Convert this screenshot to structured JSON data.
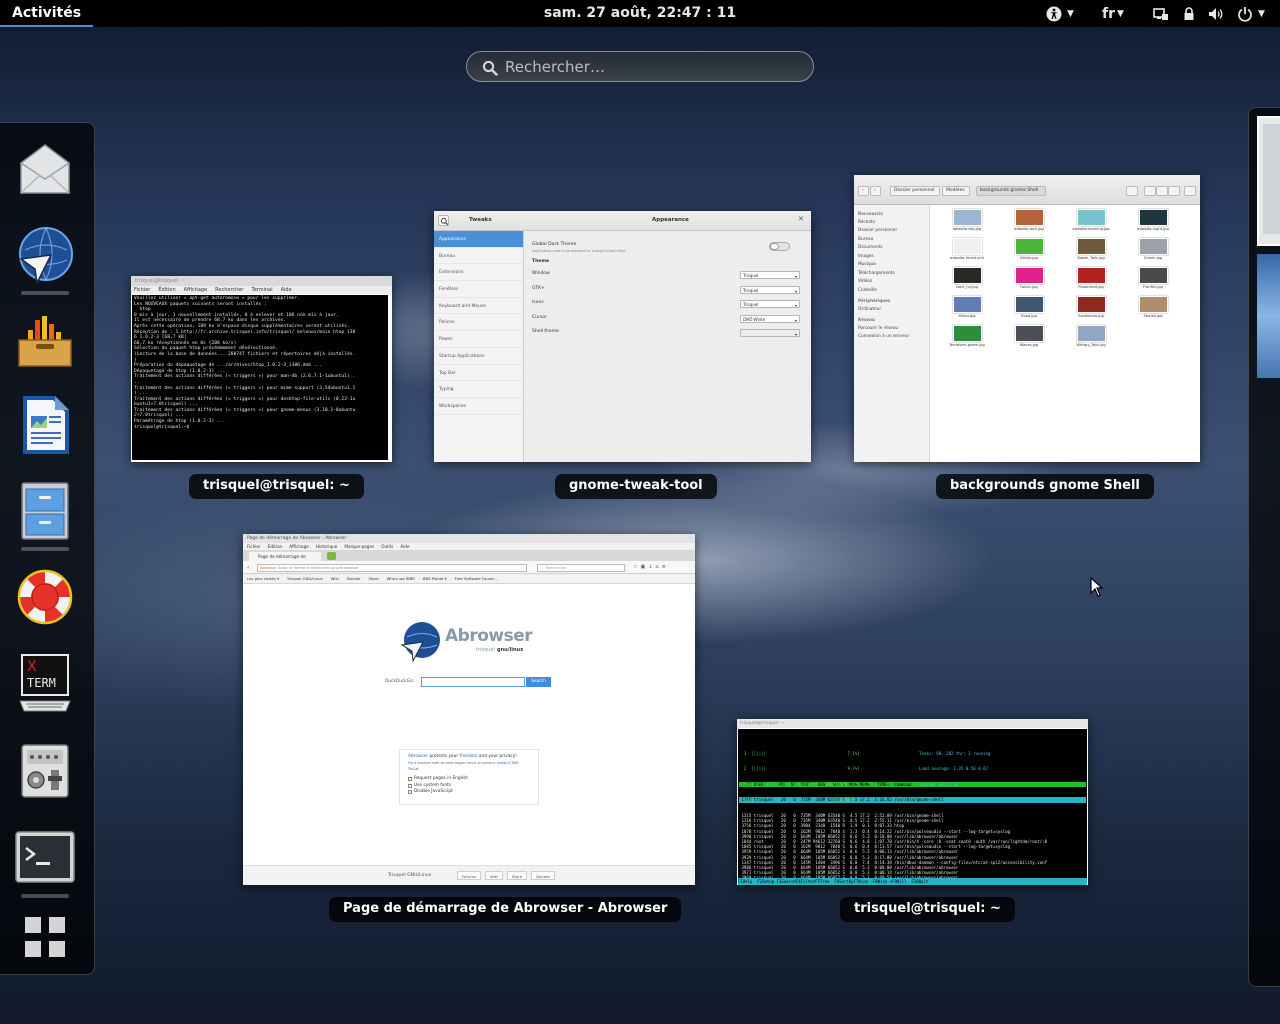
{
  "topbar": {
    "activities": "Activités",
    "clock": "sam. 27 août, 22:47 : 11",
    "language": "fr"
  },
  "search": {
    "placeholder": "Rechercher…"
  },
  "dash": {
    "apps": [
      "mail-icon",
      "abrowser-icon",
      "system-monitor-icon",
      "writer-icon",
      "file-manager-icon",
      "help-icon",
      "xterm-icon",
      "settings-icon",
      "terminal-icon",
      "show-apps-icon"
    ]
  },
  "windows": {
    "term1": {
      "caption": "trisquel@trisquel: ~",
      "titlebar": "trisquel@trisquel: ~",
      "menu": [
        "Fichier",
        "Édition",
        "Affichage",
        "Rechercher",
        "Terminal",
        "Aide"
      ],
      "lines": [
        "Veuillez utiliser « apt-get autoremove » pour les supprimer.",
        "Les NOUVEAUX paquets suivants seront installés :",
        "  htop",
        "0 mis à jour, 1 nouvellement installés, 0 à enlever et 106 non mis à jour.",
        "Il est nécessaire de prendre 68,7 ko dans les archives.",
        "Après cette opération, 189 ko d'espace disque supplémentaires seront utilisés.",
        "Réception de : 1 http://fr.archive.trisquel.info/trisquel/ belenos/main htop i38",
        "6 1.0.2-3 [68,7 kB]",
        "68,7 ko réceptionnés en 0s (208 ko/s)",
        "Sélection du paquet htop précédemment désélectionné.",
        "(Lecture de la base de données... 200747 fichiers et répertoires déjà installés.",
        ")",
        "Préparation du dépaquetage de .../archives/htop_1.0.2-3_i386.deb ...",
        "Dépaquetage de htop (1.0.2-3) ...",
        "Traitement des actions différées (« triggers ») pour man-db (2.6.7.1-1ubuntu1) .",
        "..",
        "Traitement des actions différées (« triggers ») pour mime-support (3.54ubuntu1.1",
        ") ...",
        "Traitement des actions différées (« triggers ») pour desktop-file-utils (0.22-1u",
        "buntu1+7.0trisquel) ...",
        "Traitement des actions différées (« triggers ») pour gnome-menus (3.10.1-0ubuntu",
        "2+7.0trisquel) ...",
        "Paramétrage de htop (1.0.2-3) ...",
        "trisquel@trisquel:~$ "
      ]
    },
    "tweak": {
      "caption": "gnome-tweak-tool",
      "app_title": "Tweaks",
      "page_title": "Appearance",
      "sidebar": [
        "Appearance",
        "Bureau",
        "Extensions",
        "Fenêtres",
        "Keyboard and Mouse",
        "Polices",
        "Power",
        "Startup Applications",
        "Top Bar",
        "Typing",
        "Workspaces"
      ],
      "global_dark": "Global Dark Theme",
      "global_dark_note": "Applications need to be restarted for change to take effect",
      "theme_header": "Theme",
      "rows": [
        {
          "label": "Window",
          "value": "Trisquel"
        },
        {
          "label": "GTK+",
          "value": "Trisquel"
        },
        {
          "label": "Icons",
          "value": "Trisquel"
        },
        {
          "label": "Cursor",
          "value": "DMZ-White"
        },
        {
          "label": "Shell theme",
          "value": ""
        }
      ]
    },
    "naut": {
      "caption": "backgrounds gnome Shell",
      "breadcrumbs": [
        "Dossier personnel",
        "Modèles",
        "backgrounds gnome Shell"
      ],
      "sidebar": {
        "places_header": "Raccourcis",
        "places": [
          "Récents",
          "Dossier personnel",
          "Bureau",
          "Documents",
          "Images",
          "Musique",
          "Téléchargements",
          "Vidéos",
          "Corbeille"
        ],
        "devices_header": "Périphériques",
        "devices": [
          "Ordinateur"
        ],
        "network_header": "Réseau",
        "network": [
          "Parcourir le réseau",
          "Connexion à un serveur"
        ]
      },
      "files": [
        {
          "name": "adwaita-day.jpg",
          "color": "#9ab7d6"
        },
        {
          "name": "adwaita-lock.jpg",
          "color": "#b4643a"
        },
        {
          "name": "adwaita-morning.jpg",
          "color": "#79c3d0"
        },
        {
          "name": "adwaita-night.jpg",
          "color": "#1f3540"
        },
        {
          "name": "adwaita-timed.xml",
          "color": "#f0f0f0"
        },
        {
          "name": "Blinds.jpg",
          "color": "#4db43a"
        },
        {
          "name": "Bokeh_Tails.jpg",
          "color": "#6f5a3e"
        },
        {
          "name": "Chmin.jpg",
          "color": "#9aa1ab"
        },
        {
          "name": "Dark_Ivy.jpg",
          "color": "#2a2a24"
        },
        {
          "name": "Fabric.jpg",
          "color": "#e0228a"
        },
        {
          "name": "Flowerbed.jpg",
          "color": "#b2231f"
        },
        {
          "name": "Fronfinl.jpg",
          "color": "#4a4a4a"
        },
        {
          "name": "Mirror.jpg",
          "color": "#5f7fb3"
        },
        {
          "name": "Road.jpg",
          "color": "#3e5872"
        },
        {
          "name": "Sandstone.jpg",
          "color": "#8c2a1e"
        },
        {
          "name": "Stones.jpg",
          "color": "#b08d6c"
        },
        {
          "name": "Terraform-green.jpg",
          "color": "#2f8d3a"
        },
        {
          "name": "Waves.jpg",
          "color": "#4b4f59"
        },
        {
          "name": "Whispy_Tails.jpg",
          "color": "#8fa7c4"
        }
      ]
    },
    "abrowser": {
      "caption": "Page de démarrage de Abrowser - Abrowser",
      "titlebar": "Page de démarrage de Abrowser - Abrowser",
      "menu": [
        "Fichier",
        "Édition",
        "Affichage",
        "Historique",
        "Marque-pages",
        "Outils",
        "Aide"
      ],
      "tab": "Page de démarrage de Abrowser",
      "url_badge": "Abrowser",
      "url_placeholder": "Saisir un terme à rechercher ou une adresse",
      "search_placeholder": "Rechercher",
      "bookmarks": [
        "Les plus visités ▾",
        "Trisquel GNU/Linux",
        "Wiki",
        "Donate",
        "Store",
        "Who's we IBBR",
        "BBS Planet ▾",
        "Free Software Found..."
      ],
      "logo_text": "Abrowser",
      "logo_sub1": "trisquel",
      "logo_sub2": "gnu/linux",
      "ddg_label": "DuckDuckGo:",
      "ddg_button": "Search",
      "privacy_line1a": "Abrowser",
      "privacy_line1b": " protects your ",
      "privacy_line1c": "freedom",
      "privacy_line1d": " and your privacy!",
      "privacy_line2": "For a browser with an even bigger focus on privacy:",
      "privacy_link": "Install ICEbD TorCat",
      "options": [
        "Request pages in English",
        "Use system fonts",
        "Disable JavaScript"
      ],
      "footer_brand": "Trisquel GNU/Linux",
      "footer_links": [
        "Forums",
        "Wiki",
        "Store",
        "Donate"
      ]
    },
    "htop": {
      "caption": "trisquel@trisquel: ~",
      "titlebar": "trisquel@trisquel: ~",
      "cpu": "  1  [|||||                                 7.1%]",
      "cpu2": "  2  [|||||                                 9.7%]",
      "mem": "  Mem[|||||||||||||||||||||||||||  304/301MB]",
      "swp": "  Swp[                                0/4330MB]",
      "tasks": "Tasks: 98, 202 thr; 2 running",
      "load": "Load average: 1.35 0.50 0.67",
      "uptime": "Uptime: 00:27:56",
      "header": "  PID USER      PRI  NI  VIRT   RES   SHR S CPU% MEM%   TIME+  Command",
      "selected": " 1316 trisquel   20   0  735M  340M 63540 S  6.5 17.2  1:16.82 /usr/bin/gnome-shell",
      "processes": [
        " 1315 trisquel   20   0  735M  340M 63540 S  4.5 17.2  2:52.09 /usr/bin/gnome-shell",
        " 1316 trisquel   20   0  735M  340M 63540 S  4.5 17.2  2:55.11 /usr/bin/gnome-shell",
        " 3756 trisquel   20   0  3904  2348  1540 R  1.9  0.1  0:07.33 htop",
        " 1078 trisquel   20   0  162M  9812  7040 S  1.3  0.4  0:14.22 /usr/bin/pulseaudio --start --log-target=syslog",
        " 3990 trisquel   20   0  664M  105M 66052 S  0.6  5.3  0:18.00 /usr/lib/abrowser/abrowser",
        " 1044 root       20   0  247M 94612 32760 S  0.6  4.8  1:07.70 /usr/bin/X -core :0 -seat seat0 -auth /var/run/lightdm/root/:0",
        " 1085 trisquel   20   0  162M  9812  7040 S  0.6  0.4  0:13.57 /usr/bin/pulseaudio --start --log-target=syslog",
        " 3959 trisquel   20   0  664M  105M 66052 S  0.6  5.3  0:00.13 /usr/lib/abrowser/abrowser",
        " 3929 trisquel   20   0  664M  105M 66052 S  0.0  5.3  0:17.00 /usr/lib/abrowser/abrowser",
        " 1347 trisquel   20   0  145M  1404  3496 S  0.0  7.4  0:14.38 /bin/dbus-daemon --config-file=/etc/at-spi2/accessibility.conf",
        " 3986 trisquel   20   0  664M  105M 66052 S  0.0  5.3  0:00.00 /usr/lib/abrowser/abrowser",
        " 3971 trisquel   20   0  664M  105M 66052 S  0.0  5.3  0:00.14 /usr/lib/abrowser/abrowser",
        " 3969 trisquel   20   0  664M  105M 66052 S  0.0  5.3  0:00.58 /usr/lib/abrowser/abrowser",
        " 1781 trisquel   20   0 45798   3500  3052 S  0.0  0.2  0:01.79 /usr/bin/dbus-daemon --daemonize --sin",
        " 1030 trisquel   20   0 45798   3500  3052 S  0.0  0.2  0:01.00 /usr/bin/dbus-daemon --daemonize --sin",
        " 1039 trisquel   20   0  735M  340M 63540 S  0.0 17.2  0:05.65 /usr/bin/gnome-shell"
      ],
      "fkeys": "F1Help  F2Setup F3SearchF4FilterF5Tree  F6SortByF7Nice -F8Nice +F9Kill  F10Quit"
    }
  },
  "colors": {
    "accent": "#4a90d9",
    "topbar": "#000000",
    "caption_bg": "#000000"
  }
}
